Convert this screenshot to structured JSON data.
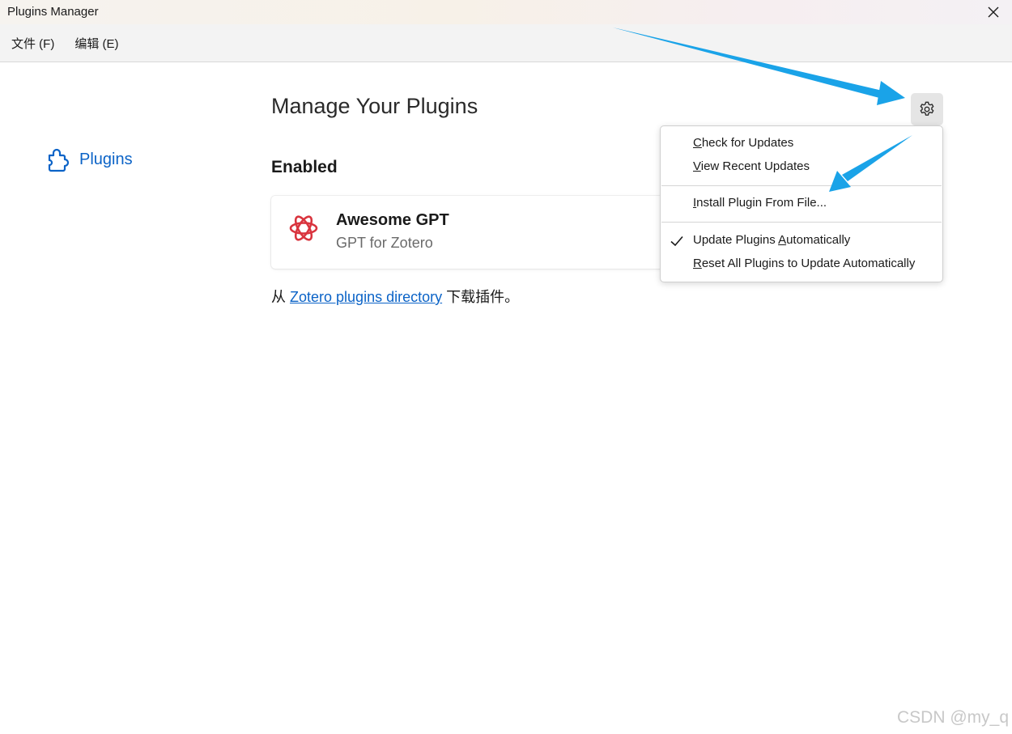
{
  "window": {
    "title": "Plugins Manager"
  },
  "menubar": {
    "items": [
      "文件 (F)",
      "编辑 (E)"
    ]
  },
  "sidebar": {
    "items": [
      {
        "label": "Plugins",
        "icon": "puzzle-icon"
      }
    ]
  },
  "main": {
    "title": "Manage Your Plugins",
    "section_heading": "Enabled",
    "plugin": {
      "name": "Awesome GPT",
      "description": "GPT for Zotero",
      "icon": "openai-icon"
    },
    "directory": {
      "prefix": "从 ",
      "link": "Zotero plugins directory",
      "suffix": " 下载插件。"
    }
  },
  "dropdown": {
    "items": [
      {
        "accesskey": "C",
        "rest": "heck for Updates"
      },
      {
        "accesskey": "V",
        "rest": "iew Recent Updates"
      },
      {
        "accesskey": "I",
        "rest": "nstall Plugin From File..."
      },
      {
        "prefix": "Update Plugins ",
        "accesskey": "A",
        "rest": "utomatically",
        "checked": true
      },
      {
        "accesskey": "R",
        "rest": "eset All Plugins to Update Automatically"
      }
    ]
  },
  "watermark": "CSDN @my_q",
  "colors": {
    "accent": "#0b63c7",
    "annotation_arrow": "#1aa3e8",
    "plugin_icon": "#d9343e"
  }
}
